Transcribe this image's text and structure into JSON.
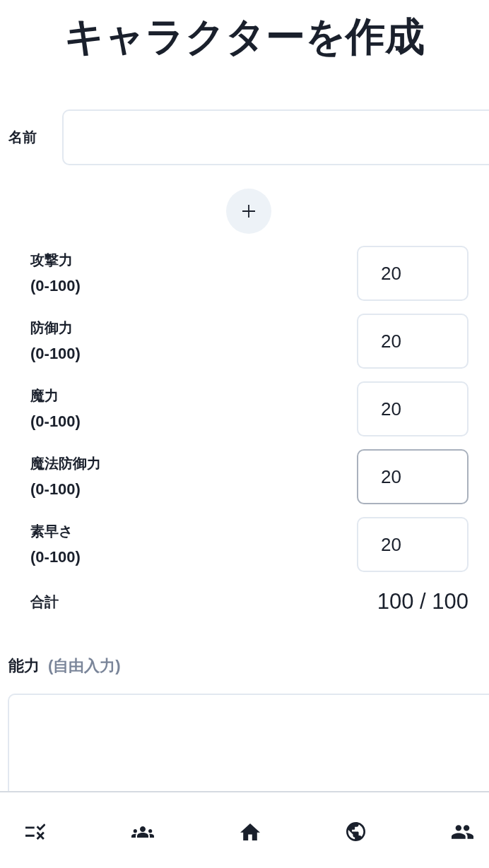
{
  "title": "キャラクターを作成",
  "name_field": {
    "label": "名前"
  },
  "stats": [
    {
      "label": "攻撃力",
      "range": "(0-100)",
      "value": "20",
      "focused": false
    },
    {
      "label": "防御力",
      "range": "(0-100)",
      "value": "20",
      "focused": false
    },
    {
      "label": "魔力",
      "range": "(0-100)",
      "value": "20",
      "focused": false
    },
    {
      "label": "魔法防御力",
      "range": "(0-100)",
      "value": "20",
      "focused": true
    },
    {
      "label": "素早さ",
      "range": "(0-100)",
      "value": "20",
      "focused": false
    }
  ],
  "total": {
    "label": "合計",
    "value": "100 / 100"
  },
  "abilities": {
    "label": "能力",
    "hint": "(自由入力)"
  }
}
